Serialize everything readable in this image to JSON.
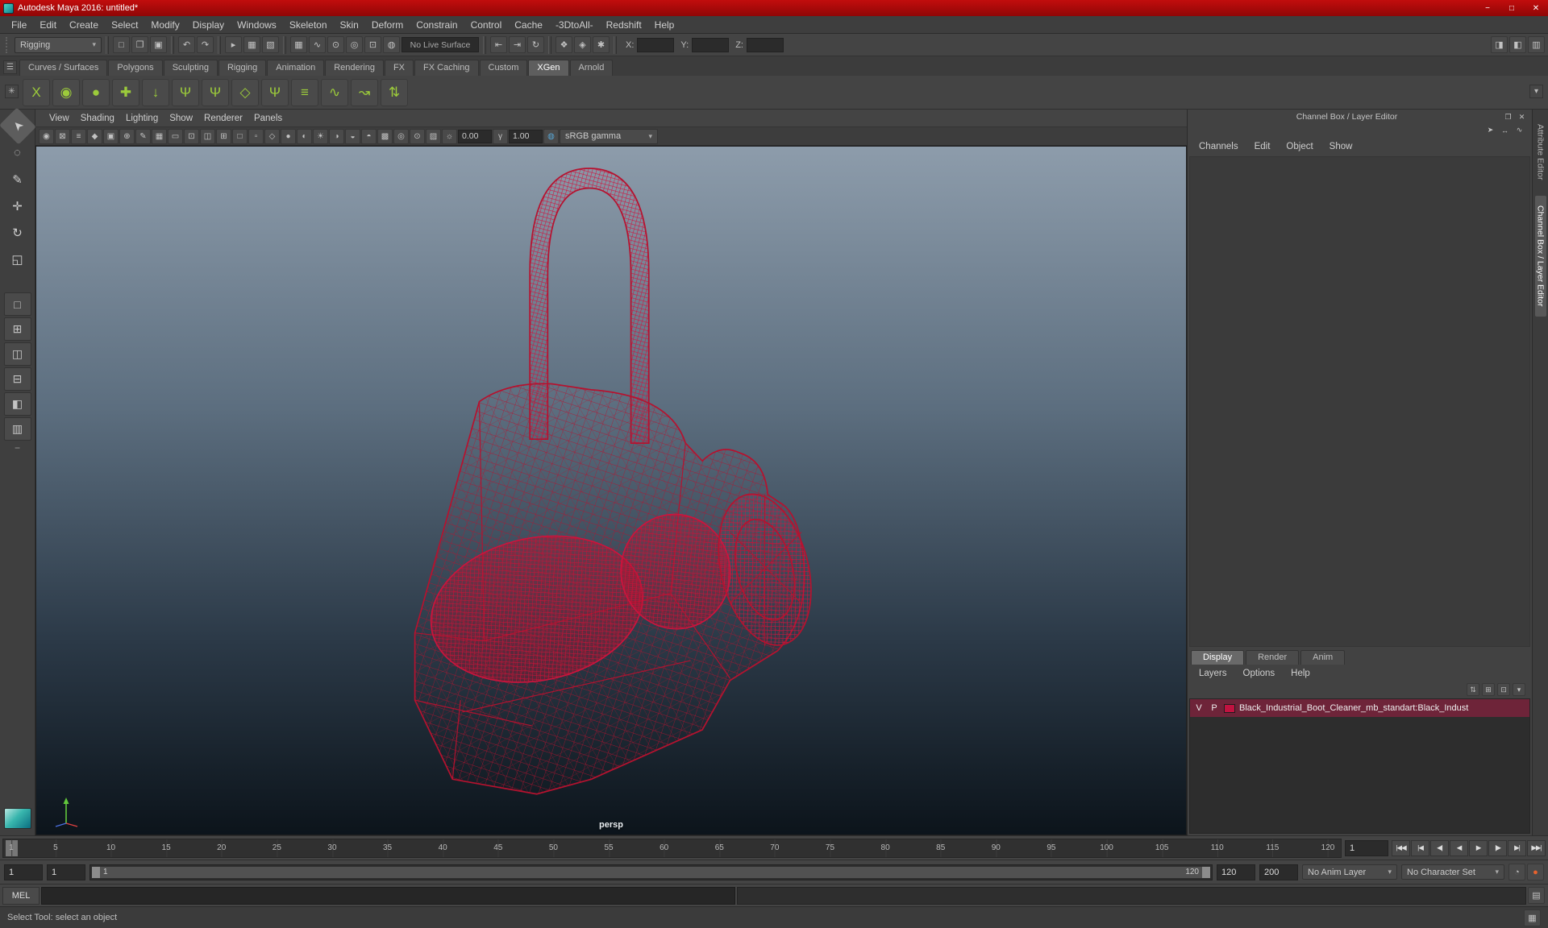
{
  "window": {
    "title": "Autodesk Maya 2016: untitled*",
    "buttons": [
      {
        "name": "minimize-button",
        "glyph": "−"
      },
      {
        "name": "maximize-button",
        "glyph": "□"
      },
      {
        "name": "close-button",
        "glyph": "✕"
      }
    ]
  },
  "menubar": {
    "items": [
      "File",
      "Edit",
      "Create",
      "Select",
      "Modify",
      "Display",
      "Windows",
      "Skeleton",
      "Skin",
      "Deform",
      "Constrain",
      "Control",
      "Cache",
      "-3DtoAll-",
      "Redshift",
      "Help"
    ]
  },
  "statusline": {
    "menu_set": "Rigging",
    "file_icons": [
      {
        "name": "new-scene-icon",
        "glyph": "□"
      },
      {
        "name": "open-scene-icon",
        "glyph": "❐"
      },
      {
        "name": "save-scene-icon",
        "glyph": "▣"
      }
    ],
    "undo_icons": [
      {
        "name": "undo-icon",
        "glyph": "↶"
      },
      {
        "name": "redo-icon",
        "glyph": "↷"
      }
    ],
    "selection_icons": [
      {
        "name": "select-by-hierarchy-icon",
        "glyph": "▸"
      },
      {
        "name": "select-by-object-icon",
        "glyph": "▦"
      },
      {
        "name": "select-by-component-icon",
        "glyph": "▧"
      }
    ],
    "snap_icons": [
      {
        "name": "snap-to-grid-icon",
        "glyph": "▦"
      },
      {
        "name": "snap-to-curve-icon",
        "glyph": "∿"
      },
      {
        "name": "snap-to-point-icon",
        "glyph": "⊙"
      },
      {
        "name": "snap-to-projected-center-icon",
        "glyph": "◎"
      },
      {
        "name": "snap-to-view-plane-icon",
        "glyph": "⊡"
      },
      {
        "name": "make-live-icon",
        "glyph": "◍"
      }
    ],
    "live_surface": "No Live Surface",
    "history_icons": [
      {
        "name": "input-connections-icon",
        "glyph": "⇤"
      },
      {
        "name": "output-connections-icon",
        "glyph": "⇥"
      },
      {
        "name": "construction-history-icon",
        "glyph": "↻"
      }
    ],
    "render_icons": [
      {
        "name": "render-frame-icon",
        "glyph": "❖"
      },
      {
        "name": "ipr-render-icon",
        "glyph": "◈"
      },
      {
        "name": "render-settings-icon",
        "glyph": "✱"
      }
    ],
    "coords": {
      "x_label": "X:",
      "y_label": "Y:",
      "z_label": "Z:",
      "x_value": "",
      "y_value": "",
      "z_value": ""
    },
    "sidebar_icons": [
      {
        "name": "toggle-attribute-editor-icon",
        "glyph": "◨"
      },
      {
        "name": "toggle-tool-settings-icon",
        "glyph": "◧"
      },
      {
        "name": "toggle-channel-box-icon",
        "glyph": "▥"
      }
    ]
  },
  "shelf": {
    "menu_icon": {
      "name": "shelf-tabs-menu-icon",
      "glyph": "☰"
    },
    "editor_icon": {
      "name": "shelf-editor-icon",
      "glyph": "✳"
    },
    "overflow_icon": {
      "name": "shelf-overflow-icon",
      "glyph": "▾"
    },
    "tabs": [
      {
        "label": "Curves / Surfaces"
      },
      {
        "label": "Polygons"
      },
      {
        "label": "Sculpting"
      },
      {
        "label": "Rigging"
      },
      {
        "label": "Animation"
      },
      {
        "label": "Rendering"
      },
      {
        "label": "FX"
      },
      {
        "label": "FX Caching"
      },
      {
        "label": "Custom"
      },
      {
        "label": "XGen",
        "active": true
      },
      {
        "label": "Arnold"
      }
    ],
    "icons": [
      {
        "name": "xgen-editor-icon",
        "glyph": "X"
      },
      {
        "name": "xgen-description-icon",
        "glyph": "◉"
      },
      {
        "name": "xgen-collection-icon",
        "glyph": "●"
      },
      {
        "name": "xgen-add-description-icon",
        "glyph": "✚"
      },
      {
        "name": "xgen-attach-icon",
        "glyph": "↓"
      },
      {
        "name": "xgen-groomable-spline-icon",
        "glyph": "Ψ"
      },
      {
        "name": "xgen-spline-guide-icon",
        "glyph": "Ψ"
      },
      {
        "name": "xgen-convert-icon",
        "glyph": "◇"
      },
      {
        "name": "xgen-comb-icon",
        "glyph": "Ψ"
      },
      {
        "name": "xgen-modifier-stack-icon",
        "glyph": "≡"
      },
      {
        "name": "xgen-curve-icon",
        "glyph": "∿"
      },
      {
        "name": "xgen-guides-from-curves-icon",
        "glyph": "↝"
      },
      {
        "name": "xgen-export-icon",
        "glyph": "⇅"
      }
    ]
  },
  "toolbox": {
    "tools": [
      {
        "name": "select-tool",
        "glyph": "➤",
        "active": true,
        "cls": "rot"
      },
      {
        "name": "lasso-tool",
        "glyph": "◌"
      },
      {
        "name": "paint-select-tool",
        "glyph": "✎"
      },
      {
        "name": "move-tool",
        "glyph": "✛"
      },
      {
        "name": "rotate-tool",
        "glyph": "↻"
      },
      {
        "name": "scale-tool",
        "glyph": "◱"
      }
    ],
    "layouts": [
      {
        "name": "single-pane-layout-button",
        "glyph": "□"
      },
      {
        "name": "four-pane-layout-button",
        "glyph": "⊞"
      },
      {
        "name": "two-pane-side-layout-button",
        "glyph": "◫"
      },
      {
        "name": "two-pane-stacked-layout-button",
        "glyph": "⊟"
      },
      {
        "name": "three-pane-layout-button",
        "glyph": "◧"
      },
      {
        "name": "outliner-persp-layout-button",
        "glyph": "▥"
      }
    ],
    "collapse_glyph": "−"
  },
  "panel": {
    "menus": [
      "View",
      "Shading",
      "Lighting",
      "Show",
      "Renderer",
      "Panels"
    ],
    "toolbar_icons": [
      {
        "name": "select-camera-icon",
        "glyph": "◉"
      },
      {
        "name": "lock-camera-icon",
        "glyph": "⊠"
      },
      {
        "name": "camera-attributes-icon",
        "glyph": "≡"
      },
      {
        "name": "bookmark-icon",
        "glyph": "◆"
      },
      {
        "name": "image-plane-icon",
        "glyph": "▣"
      },
      {
        "name": "pan-zoom-icon",
        "glyph": "⊕"
      },
      {
        "name": "grease-pencil-icon",
        "glyph": "✎"
      },
      {
        "name": "grid-icon",
        "glyph": "▦"
      },
      {
        "name": "film-gate-icon",
        "glyph": "▭"
      },
      {
        "name": "resolution-gate-icon",
        "glyph": "⊡"
      },
      {
        "name": "gate-mask-icon",
        "glyph": "◫"
      },
      {
        "name": "field-chart-icon",
        "glyph": "⊞"
      },
      {
        "name": "safe-action-icon",
        "glyph": "□"
      },
      {
        "name": "safe-title-icon",
        "glyph": "▫"
      },
      {
        "name": "wireframe-icon",
        "glyph": "◇"
      },
      {
        "name": "smooth-shade-icon",
        "glyph": "●"
      },
      {
        "name": "textured-icon",
        "glyph": "◐"
      },
      {
        "name": "use-all-lights-icon",
        "glyph": "☀"
      },
      {
        "name": "shadows-icon",
        "glyph": "◑"
      },
      {
        "name": "ssao-icon",
        "glyph": "◒"
      },
      {
        "name": "motion-blur-icon",
        "glyph": "◓"
      },
      {
        "name": "multisample-icon",
        "glyph": "▩"
      },
      {
        "name": "dof-icon",
        "glyph": "◎"
      },
      {
        "name": "isolate-select-icon",
        "glyph": "⊙"
      },
      {
        "name": "xray-icon",
        "glyph": "▨"
      }
    ],
    "exposure_icon": "☼",
    "exposure": "0.00",
    "gamma_icon": "γ",
    "gamma": "1.00",
    "color_management_icon": "◍",
    "view_transform": "sRGB gamma",
    "camera_label": "persp"
  },
  "channel_box": {
    "title": "Channel Box / Layer Editor",
    "header_icons": [
      {
        "name": "undock-panel-icon",
        "glyph": "❐"
      },
      {
        "name": "close-panel-icon",
        "glyph": "✕"
      }
    ],
    "tool_icons": [
      {
        "name": "channel-pin-icon",
        "glyph": "➤"
      },
      {
        "name": "channel-speed-icon",
        "glyph": "↔"
      },
      {
        "name": "channel-mode-icon",
        "glyph": "∿"
      }
    ],
    "menus": [
      "Channels",
      "Edit",
      "Object",
      "Show"
    ]
  },
  "layer_editor": {
    "tabs": [
      {
        "label": "Display",
        "active": true
      },
      {
        "label": "Render"
      },
      {
        "label": "Anim"
      }
    ],
    "menus": [
      "Layers",
      "Options",
      "Help"
    ],
    "icons": [
      {
        "name": "layer-sync-icon",
        "glyph": "⇅"
      },
      {
        "name": "new-empty-layer-icon",
        "glyph": "⊞"
      },
      {
        "name": "new-layer-from-selected-icon",
        "glyph": "⊡"
      },
      {
        "name": "layer-options-icon",
        "glyph": "▾"
      }
    ],
    "layer": {
      "visible": "V",
      "playback": "P",
      "name": "Black_Industrial_Boot_Cleaner_mb_standart:Black_Indust",
      "color": "#c11240"
    }
  },
  "right_tabs": {
    "items": [
      {
        "label": "Attribute Editor",
        "name": "attribute-editor-tab"
      },
      {
        "label": "Channel Box / Layer Editor",
        "name": "channel-box-tab",
        "active": true
      }
    ]
  },
  "timeline": {
    "start": 1,
    "end": 120,
    "current": "1",
    "ticks": [
      1,
      5,
      10,
      15,
      20,
      25,
      30,
      35,
      40,
      45,
      50,
      55,
      60,
      65,
      70,
      75,
      80,
      85,
      90,
      95,
      100,
      105,
      110,
      115,
      120
    ]
  },
  "playback": {
    "buttons": [
      {
        "name": "go-to-start-button",
        "glyph": "|◀◀"
      },
      {
        "name": "step-back-key-button",
        "glyph": "|◀"
      },
      {
        "name": "step-back-frame-button",
        "glyph": "◀|"
      },
      {
        "name": "play-backward-button",
        "glyph": "◀"
      },
      {
        "name": "play-forward-button",
        "glyph": "▶"
      },
      {
        "name": "step-forward-frame-button",
        "glyph": "|▶"
      },
      {
        "name": "step-forward-key-button",
        "glyph": "▶|"
      },
      {
        "name": "go-to-end-button",
        "glyph": "▶▶|"
      }
    ]
  },
  "range": {
    "anim_start": "1",
    "play_start": "1",
    "play_end": "120",
    "anim_end": "200",
    "bar_start_label": "1",
    "bar_end_label": "120",
    "anim_layer": "No Anim Layer",
    "character_set": "No Character Set",
    "icons": [
      {
        "name": "playback-speed-icon",
        "glyph": "◔"
      },
      {
        "name": "auto-key-icon",
        "glyph": "●",
        "color": "#e8622d"
      }
    ]
  },
  "command_line": {
    "label": "MEL",
    "input_value": "",
    "icons": [
      {
        "name": "script-editor-icon",
        "glyph": "▤"
      }
    ]
  },
  "help_line": {
    "text": "Select Tool: select an object",
    "icons": [
      {
        "name": "quick-help-icon",
        "glyph": "▦"
      }
    ]
  },
  "colors": {
    "wire": "#b5122f",
    "wire2": "#cf1540",
    "titlebar": "#c20d0d",
    "viewport_top": "#8d9cab",
    "viewport_bottom": "#0c141b",
    "layer_row": "#6e2439",
    "accent_green": "#9ccb3b"
  }
}
